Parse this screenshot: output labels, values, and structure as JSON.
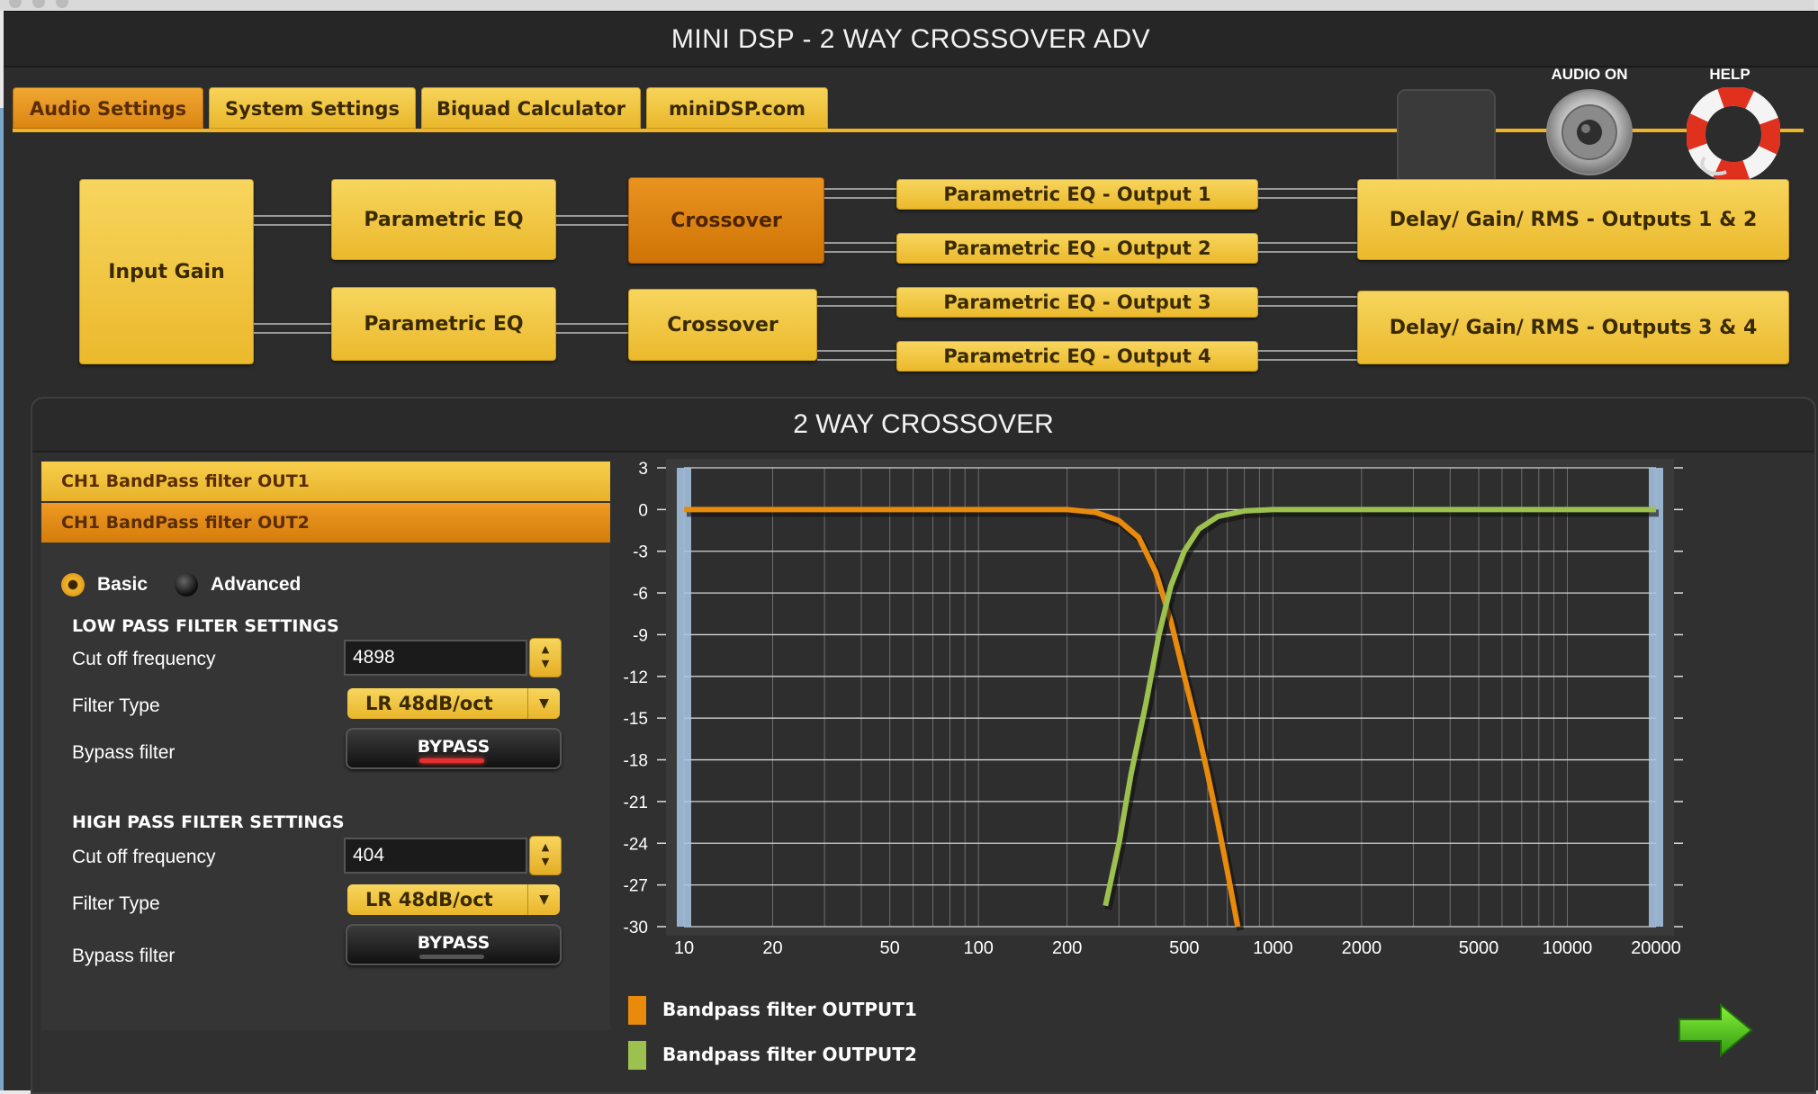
{
  "app": {
    "title": "MINI DSP - 2 WAY CROSSOVER ADV"
  },
  "tabs": [
    {
      "label": "Audio Settings",
      "active": true
    },
    {
      "label": "System Settings",
      "active": false
    },
    {
      "label": "Biquad Calculator",
      "active": false
    },
    {
      "label": "miniDSP.com",
      "active": false
    }
  ],
  "header_controls": {
    "audio_on_label": "AUDIO ON",
    "help_label": "HELP"
  },
  "flow": {
    "input_gain": "Input Gain",
    "peq_1": "Parametric EQ",
    "peq_2": "Parametric EQ",
    "crossover_1": "Crossover",
    "crossover_2": "Crossover",
    "out_peq_1": "Parametric EQ - Output 1",
    "out_peq_2": "Parametric EQ - Output 2",
    "out_peq_3": "Parametric EQ - Output 3",
    "out_peq_4": "Parametric EQ - Output 4",
    "delay_12": "Delay/ Gain/ RMS - Outputs 1 & 2",
    "delay_34": "Delay/ Gain/ RMS - Outputs 3 & 4"
  },
  "panel": {
    "title": "2 WAY CROSSOVER",
    "channels": [
      {
        "label": "CH1 BandPass filter OUT1",
        "selected": false
      },
      {
        "label": "CH1 BandPass filter OUT2",
        "selected": true
      }
    ],
    "mode": {
      "basic": "Basic",
      "advanced": "Advanced",
      "selected": "Basic"
    },
    "low_pass": {
      "title": "LOW PASS FILTER SETTINGS",
      "cutoff_label": "Cut off frequency",
      "cutoff_value": "4898",
      "type_label": "Filter Type",
      "type_value": "LR 48dB/oct",
      "bypass_label": "Bypass filter",
      "bypass_button": "BYPASS"
    },
    "high_pass": {
      "title": "HIGH PASS FILTER SETTINGS",
      "cutoff_label": "Cut off frequency",
      "cutoff_value": "404",
      "type_label": "Filter Type",
      "type_value": "LR 48dB/oct",
      "bypass_label": "Bypass filter",
      "bypass_button": "BYPASS"
    },
    "next_icon": "green-arrow-right-icon"
  },
  "colors": {
    "tab_yellow": "#f2c23a",
    "tab_orange": "#e0901a",
    "series_output1": "#e88a0c",
    "series_output2": "#9dc14e",
    "bypass_led_on": "#e53030",
    "bypass_led_off": "#555555"
  },
  "chart_data": {
    "type": "line",
    "x_scale": "log",
    "xlim": [
      10,
      20000
    ],
    "ylim": [
      -30,
      3
    ],
    "x_ticks": [
      10,
      20,
      50,
      100,
      200,
      500,
      1000,
      2000,
      5000,
      10000,
      20000
    ],
    "y_ticks": [
      3,
      0,
      -3,
      -6,
      -9,
      -12,
      -15,
      -18,
      -21,
      -24,
      -27,
      -30
    ],
    "grid": true,
    "legend_position": "bottom-left",
    "series": [
      {
        "name": "Bandpass filter OUTPUT1",
        "color": "#e88a0c",
        "points": [
          [
            10,
            0
          ],
          [
            100,
            0
          ],
          [
            200,
            0
          ],
          [
            250,
            -0.2
          ],
          [
            300,
            -0.8
          ],
          [
            350,
            -2
          ],
          [
            400,
            -4.5
          ],
          [
            450,
            -8
          ],
          [
            500,
            -12
          ],
          [
            550,
            -15.5
          ],
          [
            600,
            -19
          ],
          [
            650,
            -22.5
          ],
          [
            700,
            -26
          ],
          [
            760,
            -30
          ]
        ]
      },
      {
        "name": "Bandpass filter OUTPUT2",
        "color": "#9dc14e",
        "points": [
          [
            270,
            -28.5
          ],
          [
            300,
            -24
          ],
          [
            330,
            -19
          ],
          [
            370,
            -14
          ],
          [
            410,
            -9
          ],
          [
            450,
            -5.5
          ],
          [
            500,
            -3
          ],
          [
            560,
            -1.4
          ],
          [
            650,
            -0.5
          ],
          [
            800,
            -0.1
          ],
          [
            1000,
            0
          ],
          [
            20000,
            0
          ]
        ]
      }
    ]
  }
}
